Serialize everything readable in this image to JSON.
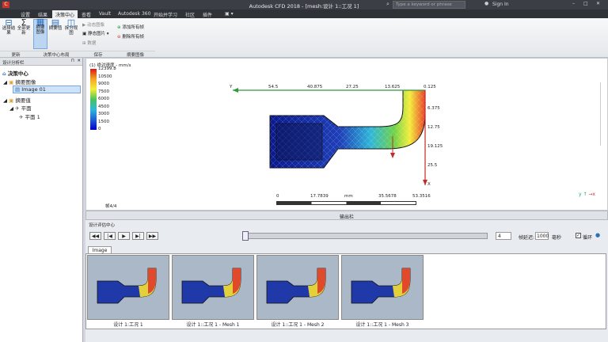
{
  "window": {
    "title": "Autodesk CFD 2018 - [mesh:设计 1::工况 1]",
    "search_placeholder": "Type a keyword or phrase",
    "signin": "Sign In"
  },
  "tabs": [
    "设置",
    "结果",
    "决策中心",
    "查看",
    "Vault",
    "Autodesk 360",
    "开始并学习",
    "社区",
    "插件"
  ],
  "ribbon": {
    "buttons": [
      "选择结果",
      "全部更新",
      "摘要图像",
      "摘要值",
      "拆分视图"
    ],
    "small": [
      "动态图像",
      "静态图片",
      "数据",
      "添加所有帧",
      "删除所有帧"
    ],
    "groups": [
      "更新",
      "决策中心布局",
      "保存",
      "摘要图像"
    ]
  },
  "panel": {
    "title": "设计分析栏",
    "tree": [
      "决策中心",
      "摘要图像",
      "Image 01",
      "摘要值",
      "平面",
      "平面 1"
    ]
  },
  "legend": {
    "title": "(1) 绝对速度 - mm/s",
    "values": [
      "12399.8",
      "10500",
      "9000",
      "7500",
      "6000",
      "4500",
      "3000",
      "1500",
      "0"
    ]
  },
  "plane_labels": {
    "top": [
      "Y",
      "54.5",
      "40.875",
      "27.25",
      "13.625",
      "0.125"
    ],
    "right": [
      "6.375",
      "12.75",
      "19.125",
      "25.5",
      "X"
    ]
  },
  "scale": {
    "values": [
      "0",
      "17.7839",
      "mm",
      "35.5678",
      "53.3516"
    ]
  },
  "frame": "帧4/4",
  "output_bar": "输出栏",
  "review": {
    "title": "设计评估中心",
    "frame_value": "4",
    "interval_label": "帧延迟:",
    "interval_value": "1000",
    "unit": "毫秒",
    "loop_label": "循环",
    "tab": "Image 01"
  },
  "thumbs": [
    "设计 1:工况 1",
    "设计 1::工况 1 - Mesh 1",
    "设计 1::工况 1 - Mesh 2",
    "设计 1::工况 1 - Mesh 3"
  ],
  "colors": {
    "accent": "#2b6fbd",
    "legend_top": "#d7191c",
    "legend_bottom": "#0000c8"
  }
}
